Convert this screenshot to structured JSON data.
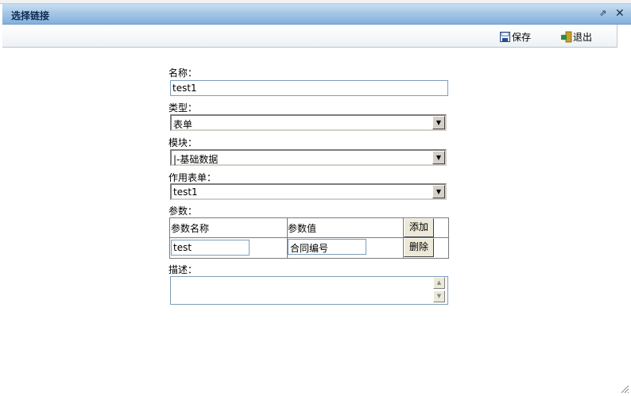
{
  "window": {
    "title": "选择链接"
  },
  "toolbar": {
    "save_label": "保存",
    "exit_label": "退出"
  },
  "form": {
    "name_label": "名称：",
    "name_value": "test1",
    "type_label": "类型：",
    "type_value": "表单",
    "module_label": "模块：",
    "module_value": "|-基础数据",
    "target_form_label": "作用表单：",
    "target_form_value": "test1",
    "params_label": "参数：",
    "params": {
      "col_name": "参数名称",
      "col_value": "参数值",
      "add_label": "添加",
      "rows": [
        {
          "name": "test",
          "value": "合同编号",
          "delete_label": "删除"
        }
      ]
    },
    "desc_label": "描述：",
    "desc_value": ""
  },
  "icons": {
    "save": "save-icon",
    "exit": "exit-icon",
    "restore": "restore-icon",
    "close": "close-icon"
  }
}
